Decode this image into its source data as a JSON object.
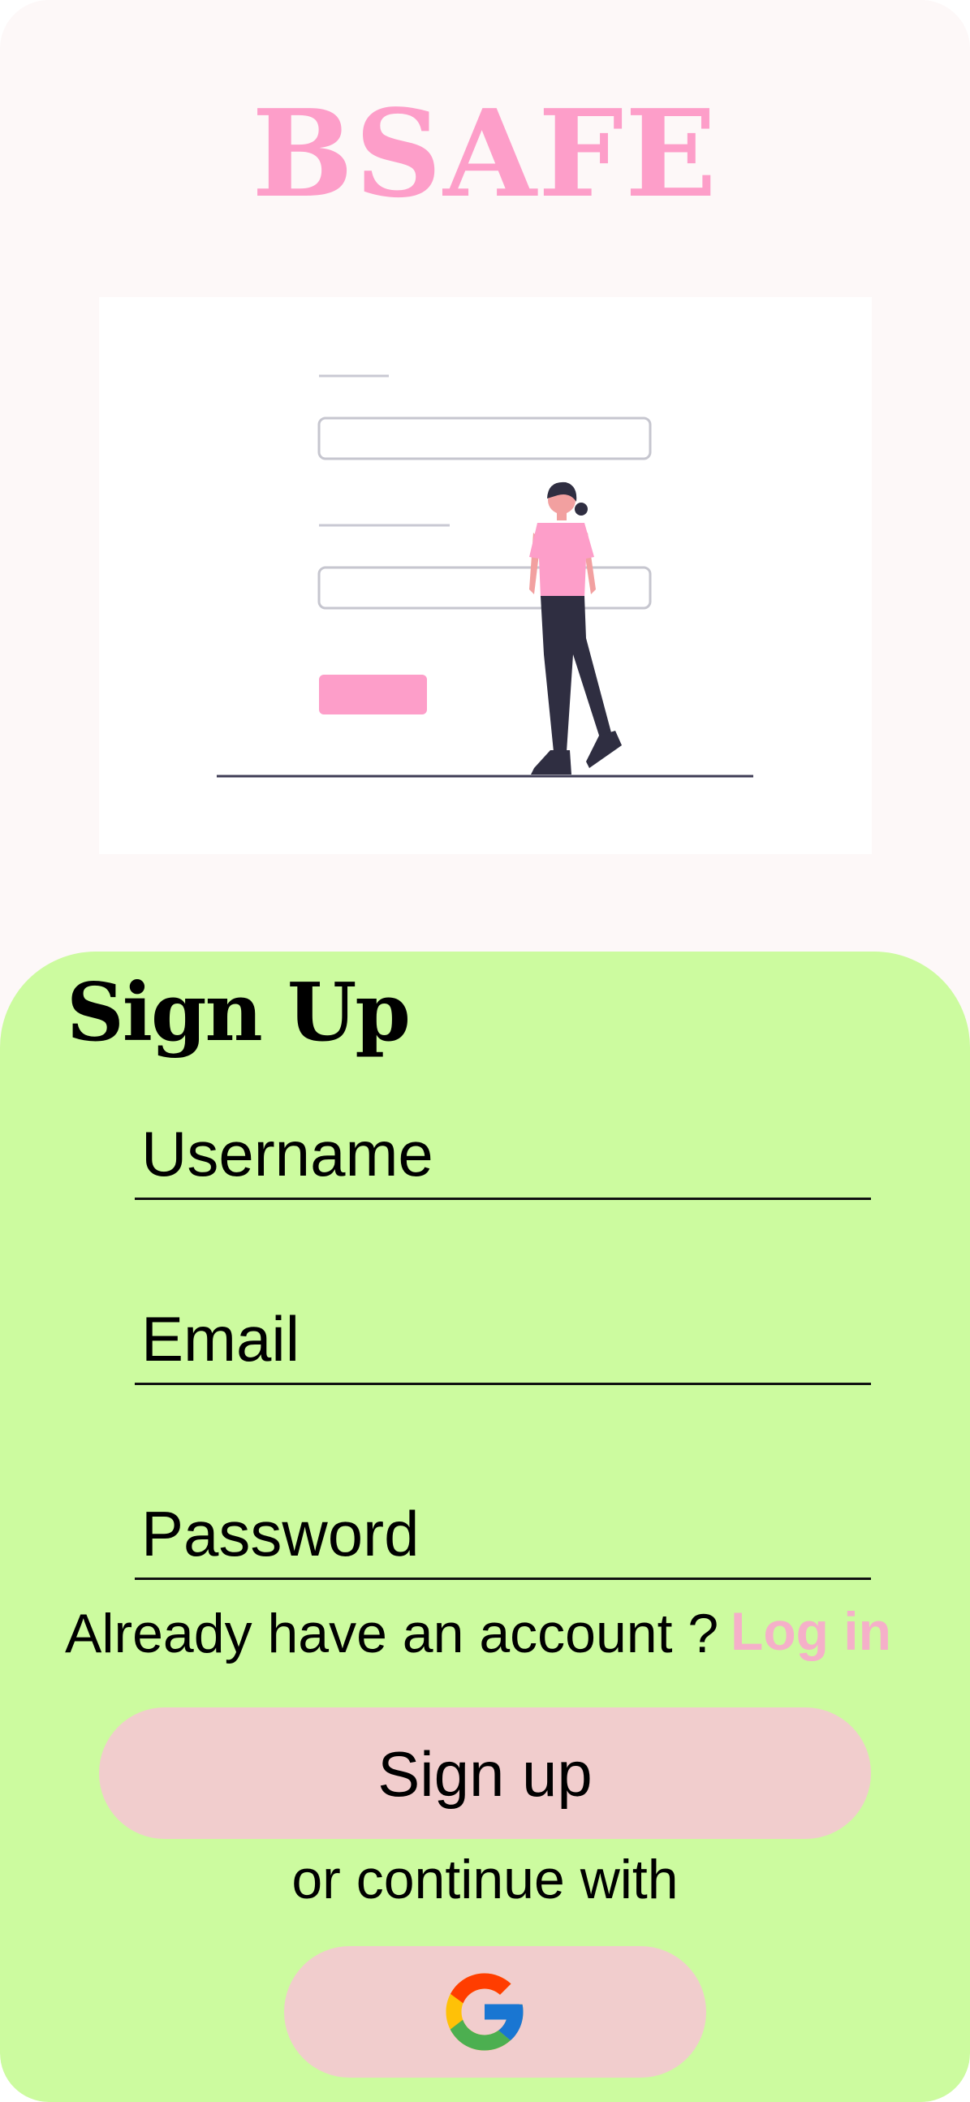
{
  "app": {
    "brand": "BSAFE"
  },
  "signup": {
    "title": "Sign Up",
    "username_placeholder": "Username",
    "email_placeholder": "Email",
    "password_placeholder": "Password",
    "account_prompt": "Already have an account ?",
    "login_link": "Log in",
    "submit_label": "Sign up",
    "alt_text": "or continue with",
    "google_icon": "google-icon"
  },
  "colors": {
    "brand_pink": "#fd9ec9",
    "panel_green": "#ccfb9f",
    "button_pink": "#f1cdcd",
    "link_pink": "#f5b0c9",
    "background": "#fdf8f8"
  }
}
